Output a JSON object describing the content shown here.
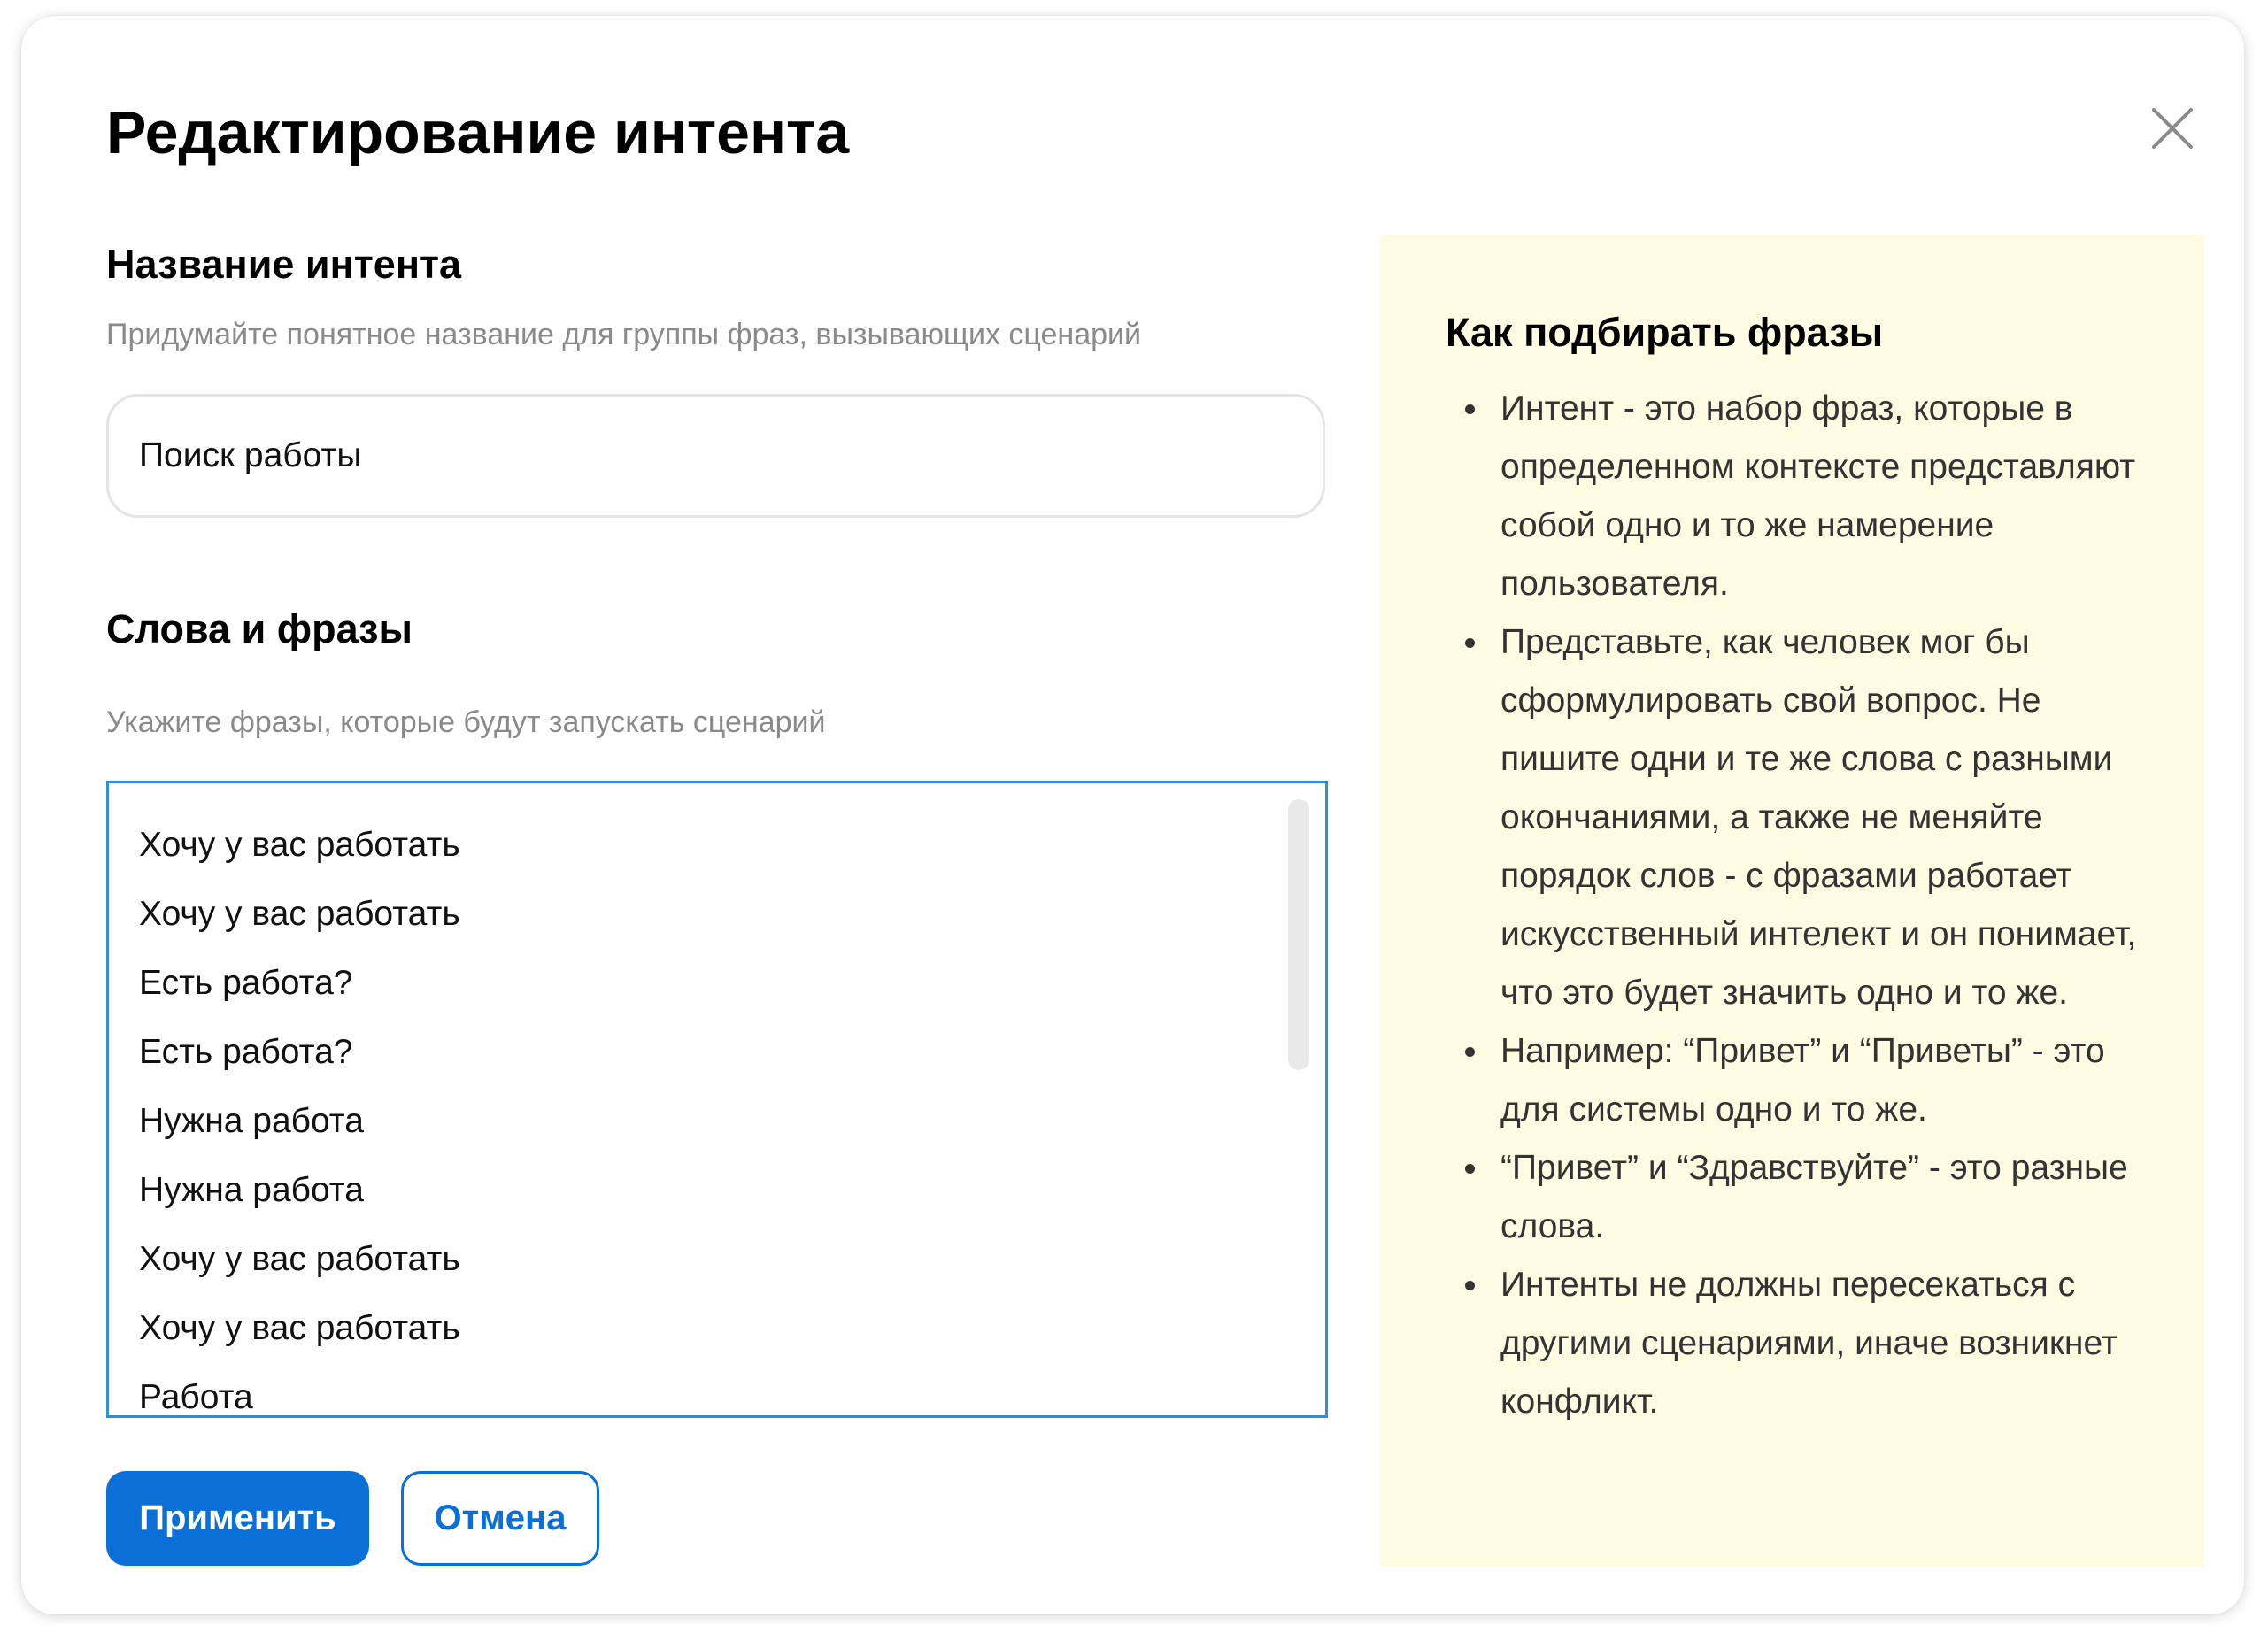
{
  "dialog": {
    "title": "Редактирование интента"
  },
  "intent_name": {
    "heading": "Название интента",
    "hint": "Придумайте понятное название для группы фраз, вызывающих сценарий",
    "value": "Поиск работы"
  },
  "phrases": {
    "heading": "Слова и фразы",
    "hint": "Укажите фразы, которые будут запускать сценарий",
    "items": [
      "Хочу у вас работать",
      "Хочу у вас работать",
      "Есть работа?",
      "Есть работа?",
      "Нужна работа",
      "Нужна работа",
      "Хочу у вас работать",
      "Хочу у вас работать",
      "Работа"
    ]
  },
  "actions": {
    "apply_label": "Применить",
    "cancel_label": "Отмена"
  },
  "tips": {
    "title": "Как подбирать фразы",
    "items": [
      "Интент - это набор фраз, которые в определенном контексте представляют собой одно и то же намерение пользователя.",
      "Представьте, как человек мог бы сформулировать свой вопрос. Не пишите одни и те же слова с разными окончаниями, а также не меняйте порядок слов - с фразами работает искусственный интелект и он понимает, что это будет значить одно и то же.",
      "Например: “Привет” и “Приветы” - это для системы одно и то же.",
      "“Привет” и “Здравствуйте” - это разные слова.",
      "Интенты не должны пересекаться с другими сценариями, иначе возникнет конфликт."
    ]
  },
  "colors": {
    "accent": "#0b6fd8",
    "focus_border": "#2d8fd4",
    "tips_background": "#fdfbe1"
  },
  "icons": {
    "close": "close-icon",
    "bullet": "bullet-dot"
  }
}
